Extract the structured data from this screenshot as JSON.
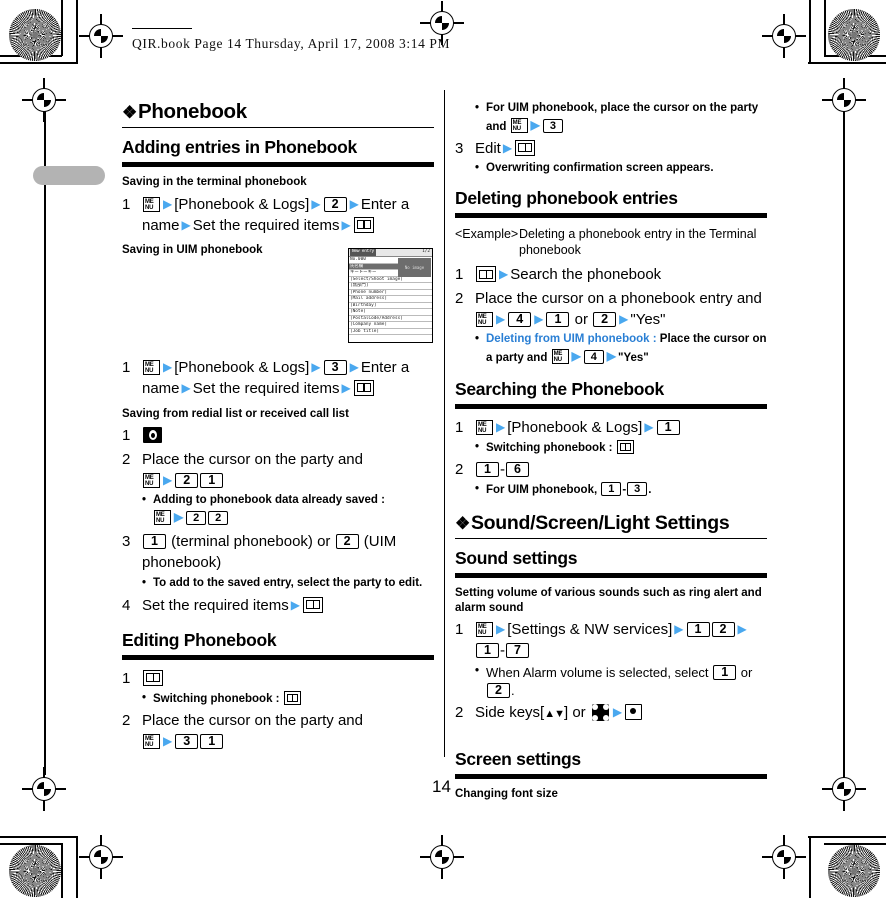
{
  "page": {
    "header_line": "QIR.book  Page 14  Thursday, April 17, 2008  3:14 PM",
    "page_number": "14"
  },
  "left_column": {
    "chapter_title": "Phonebook",
    "sections": [
      {
        "title": "Adding entries in Phonebook",
        "sub_blocks": [
          {
            "sub_title": "Saving in the terminal phonebook",
            "steps": [
              {
                "num": "1",
                "parts": [
                  "menu-icon",
                  "arrow",
                  "[Phonebook & Logs]",
                  "arrow",
                  "key:2",
                  "arrow",
                  "Enter a name",
                  "arrow",
                  "Set the required items",
                  "arrow",
                  "book-icon"
                ]
              }
            ]
          },
          {
            "sub_title": "Saving in UIM phonebook",
            "steps": [
              {
                "num": "1",
                "parts": [
                  "menu-icon",
                  "arrow",
                  "[Phonebook & Logs]",
                  "arrow",
                  "key:3",
                  "arrow",
                  "Enter a name",
                  "arrow",
                  "Set the required items",
                  "arrow",
                  "book-icon"
                ]
              }
            ]
          },
          {
            "sub_title": "Saving from redial list or received call list",
            "steps": [
              {
                "num": "1",
                "parts": [
                  "redial-icon"
                ]
              },
              {
                "num": "2",
                "parts": [
                  "Place the cursor on the party and",
                  "menu-icon",
                  "arrow",
                  "key:2",
                  "key:1"
                ]
              },
              {
                "num": "3",
                "parts": [
                  "key:1",
                  "(terminal phonebook) or",
                  "key:2",
                  "(UIM phonebook)"
                ]
              },
              {
                "num": "4",
                "parts": [
                  "Set the required items",
                  "arrow",
                  "book-icon"
                ]
              }
            ],
            "bullets": [
              {
                "after_step": "2",
                "text": "Adding to phonebook data already saved :",
                "keys": [
                  "menu-icon",
                  "arrow",
                  "key:2",
                  "key:2"
                ]
              },
              {
                "after_step": "3",
                "text": "To add to the saved entry, select the party to edit."
              }
            ]
          }
        ]
      },
      {
        "title": "Editing Phonebook",
        "steps": [
          {
            "num": "1",
            "parts": [
              "book-icon"
            ]
          },
          {
            "num": "2",
            "parts": [
              "Place the cursor on the party and",
              "menu-icon",
              "arrow",
              "key:3",
              "key:1"
            ]
          }
        ],
        "bullets": [
          {
            "after_step": "1",
            "text": "Switching phonebook :",
            "keys": [
              "book-icon"
            ]
          }
        ]
      }
    ],
    "phone_screenshot": {
      "title": "New entry",
      "page_indicator": "1/2",
      "thumb_label": "No image",
      "rows": [
        "No.000",
        "氏名欄",
        "キートーキー",
        "[Select/Shoot image]",
        "[無部門]",
        "[Phone number]",
        "[Mail address]",
        "[Birthday]",
        "[Note]",
        "[PostalCode/Address]",
        "[Company name]",
        "[Job title]"
      ]
    }
  },
  "right_column": {
    "continued_bullets": [
      {
        "text": "For UIM phonebook, place the cursor on the party and",
        "keys": [
          "menu-icon",
          "arrow",
          "key:3"
        ]
      }
    ],
    "continued_steps": [
      {
        "num": "3",
        "parts": [
          "Edit",
          "arrow",
          "book-icon"
        ]
      }
    ],
    "continued_bullets2": [
      {
        "text": "Overwriting confirmation screen appears."
      }
    ],
    "sections": [
      {
        "title": "Deleting phonebook entries",
        "example": {
          "label": "<Example>",
          "text": "Deleting a phonebook entry in the Terminal phonebook"
        },
        "steps": [
          {
            "num": "1",
            "parts": [
              "book-icon",
              "arrow",
              "Search the phonebook"
            ]
          },
          {
            "num": "2",
            "parts": [
              "Place the cursor on a phonebook entry and",
              "menu-icon",
              "arrow",
              "key:4",
              "arrow",
              "key:1",
              "or",
              "key:2",
              "arrow",
              "\"Yes\""
            ]
          }
        ],
        "bullets": [
          {
            "after_step": "2",
            "keyword": "Deleting from UIM phonebook :",
            "text": "Place the cursor on a party and",
            "keys": [
              "menu-icon",
              "arrow",
              "key:4",
              "arrow",
              "\"Yes\""
            ]
          }
        ]
      },
      {
        "title": "Searching the Phonebook",
        "steps": [
          {
            "num": "1",
            "parts": [
              "menu-icon",
              "arrow",
              "[Phonebook & Logs]",
              "arrow",
              "key:1"
            ]
          },
          {
            "num": "2",
            "parts": [
              "key:1",
              "-",
              "key:6"
            ]
          }
        ],
        "bullets": [
          {
            "after_step": "1",
            "text": "Switching phonebook :",
            "keys": [
              "book-icon"
            ]
          },
          {
            "after_step": "2",
            "text": "For UIM phonebook,",
            "keys": [
              "key:1",
              "-",
              "key:3"
            ],
            "suffix": "."
          }
        ]
      }
    ],
    "chapter_title": "Sound/Screen/Light Settings",
    "sections2": [
      {
        "title": "Sound settings",
        "sub_title": "Setting volume of various sounds such as ring alert and alarm sound",
        "steps": [
          {
            "num": "1",
            "parts": [
              "menu-icon",
              "arrow",
              "[Settings & NW services]",
              "arrow",
              "key:1",
              "key:2",
              "arrow",
              "key:1",
              "-",
              "key:7"
            ]
          },
          {
            "num": "2",
            "parts": [
              "Side keys[▲▼] or",
              "nav-icon",
              "arrow",
              "select-icon"
            ]
          }
        ],
        "bullets": [
          {
            "after_step": "1",
            "text": "When Alarm volume is selected, select",
            "keys": [
              "key:1"
            ],
            "text2": "or",
            "keys2": [
              "key:2"
            ],
            "suffix": "."
          }
        ]
      },
      {
        "title": "Screen settings",
        "sub_title": "Changing font size"
      }
    ]
  },
  "colors": {
    "arrow_blue": "#4aa8ef",
    "keyword_blue": "#2a7fd4",
    "rule_black": "#000000",
    "tab_gray": "#b3b3b3"
  }
}
